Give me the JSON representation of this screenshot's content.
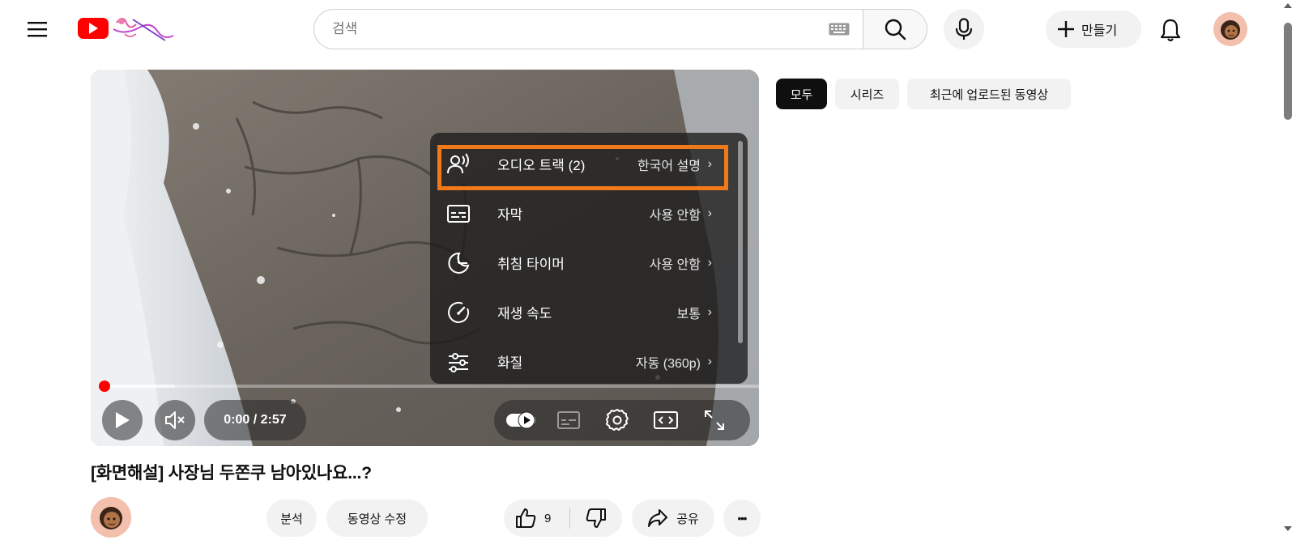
{
  "header": {
    "search_placeholder": "검색",
    "create_label": "만들기"
  },
  "player": {
    "time": "0:00 / 2:57",
    "settings": [
      {
        "label": "오디오 트랙 (2)",
        "value": "한국어 설명",
        "icon": "audio-track-icon"
      },
      {
        "label": "자막",
        "value": "사용 안함",
        "icon": "subtitles-icon"
      },
      {
        "label": "취침 타이머",
        "value": "사용 안함",
        "icon": "sleep-timer-icon"
      },
      {
        "label": "재생 속도",
        "value": "보통",
        "icon": "playback-speed-icon"
      },
      {
        "label": "화질",
        "value": "자동 (360p)",
        "icon": "quality-icon"
      }
    ],
    "chevron": "›"
  },
  "chips": [
    "모두",
    "시리즈",
    "최근에 업로드된 동영상"
  ],
  "video": {
    "title": "[화면해설] 사장님 두쫀쿠 남아있나요...?",
    "analytics_label": "분석",
    "edit_label": "동영상 수정",
    "like_count": "9",
    "share_label": "공유",
    "more_label": "•••"
  },
  "colors": {
    "accent_red": "#ff0000",
    "highlight_orange": "#f07a1a",
    "chip_active": "#0f0f0f"
  }
}
